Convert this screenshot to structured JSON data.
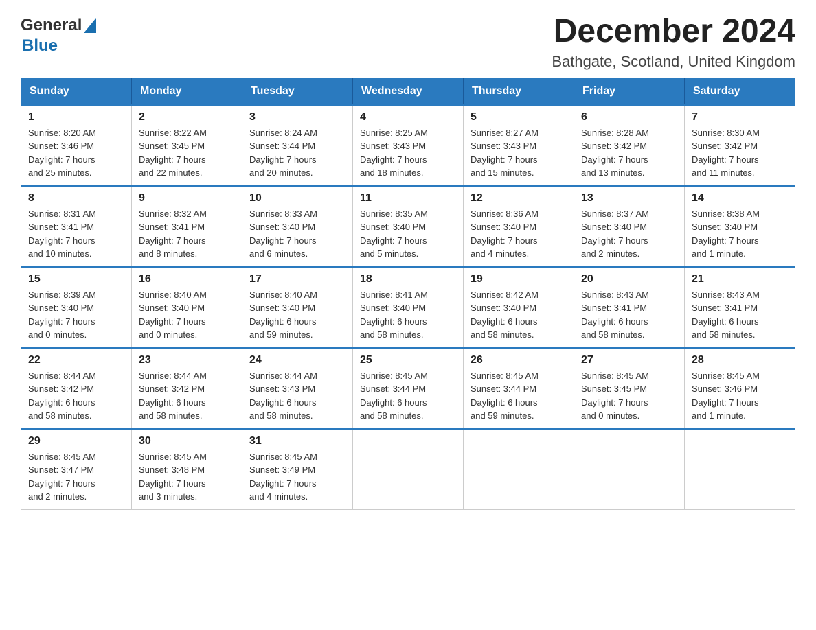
{
  "header": {
    "logo_general": "General",
    "logo_blue": "Blue",
    "month_title": "December 2024",
    "location": "Bathgate, Scotland, United Kingdom"
  },
  "days_of_week": [
    "Sunday",
    "Monday",
    "Tuesday",
    "Wednesday",
    "Thursday",
    "Friday",
    "Saturday"
  ],
  "weeks": [
    [
      {
        "day": "1",
        "sunrise": "Sunrise: 8:20 AM",
        "sunset": "Sunset: 3:46 PM",
        "daylight": "Daylight: 7 hours",
        "daylight2": "and 25 minutes."
      },
      {
        "day": "2",
        "sunrise": "Sunrise: 8:22 AM",
        "sunset": "Sunset: 3:45 PM",
        "daylight": "Daylight: 7 hours",
        "daylight2": "and 22 minutes."
      },
      {
        "day": "3",
        "sunrise": "Sunrise: 8:24 AM",
        "sunset": "Sunset: 3:44 PM",
        "daylight": "Daylight: 7 hours",
        "daylight2": "and 20 minutes."
      },
      {
        "day": "4",
        "sunrise": "Sunrise: 8:25 AM",
        "sunset": "Sunset: 3:43 PM",
        "daylight": "Daylight: 7 hours",
        "daylight2": "and 18 minutes."
      },
      {
        "day": "5",
        "sunrise": "Sunrise: 8:27 AM",
        "sunset": "Sunset: 3:43 PM",
        "daylight": "Daylight: 7 hours",
        "daylight2": "and 15 minutes."
      },
      {
        "day": "6",
        "sunrise": "Sunrise: 8:28 AM",
        "sunset": "Sunset: 3:42 PM",
        "daylight": "Daylight: 7 hours",
        "daylight2": "and 13 minutes."
      },
      {
        "day": "7",
        "sunrise": "Sunrise: 8:30 AM",
        "sunset": "Sunset: 3:42 PM",
        "daylight": "Daylight: 7 hours",
        "daylight2": "and 11 minutes."
      }
    ],
    [
      {
        "day": "8",
        "sunrise": "Sunrise: 8:31 AM",
        "sunset": "Sunset: 3:41 PM",
        "daylight": "Daylight: 7 hours",
        "daylight2": "and 10 minutes."
      },
      {
        "day": "9",
        "sunrise": "Sunrise: 8:32 AM",
        "sunset": "Sunset: 3:41 PM",
        "daylight": "Daylight: 7 hours",
        "daylight2": "and 8 minutes."
      },
      {
        "day": "10",
        "sunrise": "Sunrise: 8:33 AM",
        "sunset": "Sunset: 3:40 PM",
        "daylight": "Daylight: 7 hours",
        "daylight2": "and 6 minutes."
      },
      {
        "day": "11",
        "sunrise": "Sunrise: 8:35 AM",
        "sunset": "Sunset: 3:40 PM",
        "daylight": "Daylight: 7 hours",
        "daylight2": "and 5 minutes."
      },
      {
        "day": "12",
        "sunrise": "Sunrise: 8:36 AM",
        "sunset": "Sunset: 3:40 PM",
        "daylight": "Daylight: 7 hours",
        "daylight2": "and 4 minutes."
      },
      {
        "day": "13",
        "sunrise": "Sunrise: 8:37 AM",
        "sunset": "Sunset: 3:40 PM",
        "daylight": "Daylight: 7 hours",
        "daylight2": "and 2 minutes."
      },
      {
        "day": "14",
        "sunrise": "Sunrise: 8:38 AM",
        "sunset": "Sunset: 3:40 PM",
        "daylight": "Daylight: 7 hours",
        "daylight2": "and 1 minute."
      }
    ],
    [
      {
        "day": "15",
        "sunrise": "Sunrise: 8:39 AM",
        "sunset": "Sunset: 3:40 PM",
        "daylight": "Daylight: 7 hours",
        "daylight2": "and 0 minutes."
      },
      {
        "day": "16",
        "sunrise": "Sunrise: 8:40 AM",
        "sunset": "Sunset: 3:40 PM",
        "daylight": "Daylight: 7 hours",
        "daylight2": "and 0 minutes."
      },
      {
        "day": "17",
        "sunrise": "Sunrise: 8:40 AM",
        "sunset": "Sunset: 3:40 PM",
        "daylight": "Daylight: 6 hours",
        "daylight2": "and 59 minutes."
      },
      {
        "day": "18",
        "sunrise": "Sunrise: 8:41 AM",
        "sunset": "Sunset: 3:40 PM",
        "daylight": "Daylight: 6 hours",
        "daylight2": "and 58 minutes."
      },
      {
        "day": "19",
        "sunrise": "Sunrise: 8:42 AM",
        "sunset": "Sunset: 3:40 PM",
        "daylight": "Daylight: 6 hours",
        "daylight2": "and 58 minutes."
      },
      {
        "day": "20",
        "sunrise": "Sunrise: 8:43 AM",
        "sunset": "Sunset: 3:41 PM",
        "daylight": "Daylight: 6 hours",
        "daylight2": "and 58 minutes."
      },
      {
        "day": "21",
        "sunrise": "Sunrise: 8:43 AM",
        "sunset": "Sunset: 3:41 PM",
        "daylight": "Daylight: 6 hours",
        "daylight2": "and 58 minutes."
      }
    ],
    [
      {
        "day": "22",
        "sunrise": "Sunrise: 8:44 AM",
        "sunset": "Sunset: 3:42 PM",
        "daylight": "Daylight: 6 hours",
        "daylight2": "and 58 minutes."
      },
      {
        "day": "23",
        "sunrise": "Sunrise: 8:44 AM",
        "sunset": "Sunset: 3:42 PM",
        "daylight": "Daylight: 6 hours",
        "daylight2": "and 58 minutes."
      },
      {
        "day": "24",
        "sunrise": "Sunrise: 8:44 AM",
        "sunset": "Sunset: 3:43 PM",
        "daylight": "Daylight: 6 hours",
        "daylight2": "and 58 minutes."
      },
      {
        "day": "25",
        "sunrise": "Sunrise: 8:45 AM",
        "sunset": "Sunset: 3:44 PM",
        "daylight": "Daylight: 6 hours",
        "daylight2": "and 58 minutes."
      },
      {
        "day": "26",
        "sunrise": "Sunrise: 8:45 AM",
        "sunset": "Sunset: 3:44 PM",
        "daylight": "Daylight: 6 hours",
        "daylight2": "and 59 minutes."
      },
      {
        "day": "27",
        "sunrise": "Sunrise: 8:45 AM",
        "sunset": "Sunset: 3:45 PM",
        "daylight": "Daylight: 7 hours",
        "daylight2": "and 0 minutes."
      },
      {
        "day": "28",
        "sunrise": "Sunrise: 8:45 AM",
        "sunset": "Sunset: 3:46 PM",
        "daylight": "Daylight: 7 hours",
        "daylight2": "and 1 minute."
      }
    ],
    [
      {
        "day": "29",
        "sunrise": "Sunrise: 8:45 AM",
        "sunset": "Sunset: 3:47 PM",
        "daylight": "Daylight: 7 hours",
        "daylight2": "and 2 minutes."
      },
      {
        "day": "30",
        "sunrise": "Sunrise: 8:45 AM",
        "sunset": "Sunset: 3:48 PM",
        "daylight": "Daylight: 7 hours",
        "daylight2": "and 3 minutes."
      },
      {
        "day": "31",
        "sunrise": "Sunrise: 8:45 AM",
        "sunset": "Sunset: 3:49 PM",
        "daylight": "Daylight: 7 hours",
        "daylight2": "and 4 minutes."
      },
      null,
      null,
      null,
      null
    ]
  ]
}
